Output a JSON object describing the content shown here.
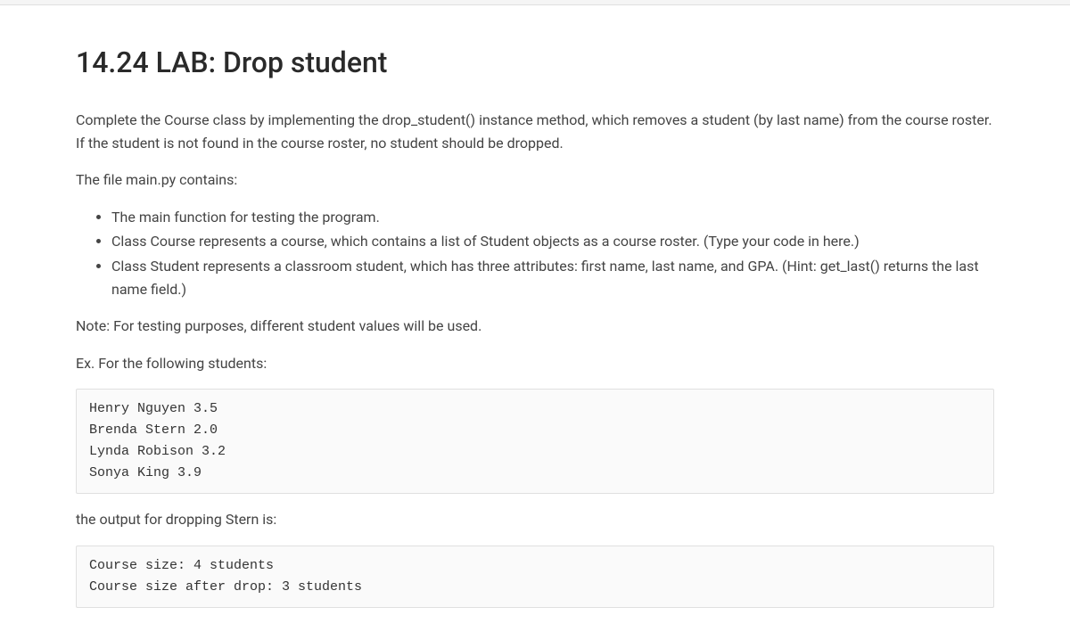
{
  "title": "14.24 LAB: Drop student",
  "intro_paragraph": "Complete the Course class by implementing the drop_student() instance method, which removes a student (by last name) from the course roster. If the student is not found in the course roster, no student should be dropped.",
  "file_paragraph": "The file main.py contains:",
  "bullets": [
    "The main function for testing the program.",
    "Class Course represents a course, which contains a list of Student objects as a course roster. (Type your code in here.)",
    "Class Student represents a classroom student, which has three attributes: first name, last name, and GPA. (Hint: get_last() returns the last name field.)"
  ],
  "note_paragraph": "Note: For testing purposes, different student values will be used.",
  "example_intro": "Ex. For the following students:",
  "code_block_1": "Henry Nguyen 3.5\nBrenda Stern 2.0\nLynda Robison 3.2\nSonya King 3.9",
  "output_intro": "the output for dropping Stern is:",
  "code_block_2": "Course size: 4 students\nCourse size after drop: 3 students"
}
